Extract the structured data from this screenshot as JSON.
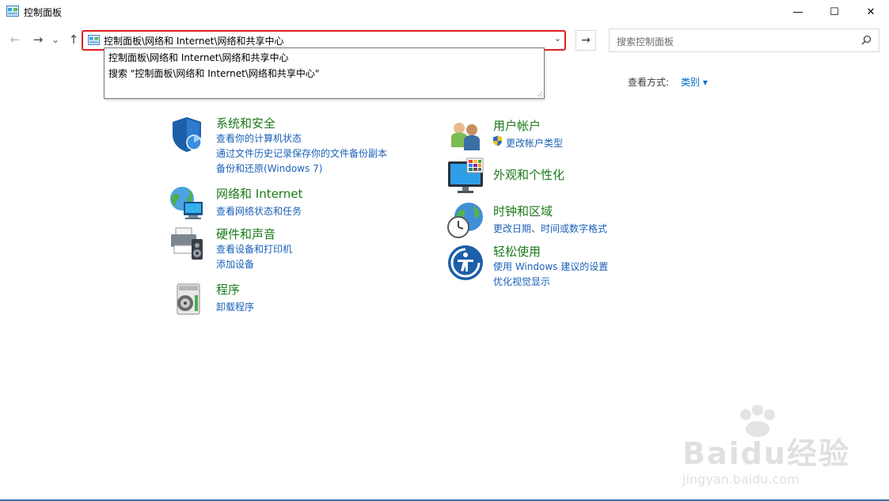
{
  "window": {
    "title": "控制面板",
    "minimize_label": "—",
    "maximize_label": "☐",
    "close_label": "✕"
  },
  "nav": {
    "back": "←",
    "forward": "→",
    "recent": "⌄",
    "up": "↑",
    "address_value": "控制面板\\网络和 Internet\\网络和共享中心",
    "address_dropdown": "⌄",
    "go": "→",
    "search_placeholder": "搜索控制面板"
  },
  "autocomplete": {
    "items": [
      "控制面板\\网络和 Internet\\网络和共享中心",
      "搜索 \"控制面板\\网络和 Internet\\网络和共享中心\""
    ]
  },
  "view_by": {
    "label": "查看方式:",
    "value": "类别 ▾"
  },
  "categories": {
    "system_security": {
      "title": "系统和安全",
      "links": [
        "查看你的计算机状态",
        "通过文件历史记录保存你的文件备份副本",
        "备份和还原(Windows 7)"
      ]
    },
    "network": {
      "title": "网络和 Internet",
      "links": [
        "查看网络状态和任务"
      ]
    },
    "hardware": {
      "title": "硬件和声音",
      "links": [
        "查看设备和打印机",
        "添加设备"
      ]
    },
    "programs": {
      "title": "程序",
      "links": [
        "卸载程序"
      ]
    },
    "user_accounts": {
      "title": "用户帐户",
      "links": [
        "更改帐户类型"
      ]
    },
    "appearance": {
      "title": "外观和个性化",
      "links": []
    },
    "clock_region": {
      "title": "时钟和区域",
      "links": [
        "更改日期、时间或数字格式"
      ]
    },
    "ease_access": {
      "title": "轻松使用",
      "links": [
        "使用 Windows 建议的设置",
        "优化视觉显示"
      ]
    }
  },
  "watermark": {
    "text": "Baidu经验",
    "url_text": "jingyan.baidu.com"
  },
  "colors": {
    "category_title": "#1a7a1a",
    "link": "#1a60b8",
    "highlight_border": "#e02020"
  }
}
